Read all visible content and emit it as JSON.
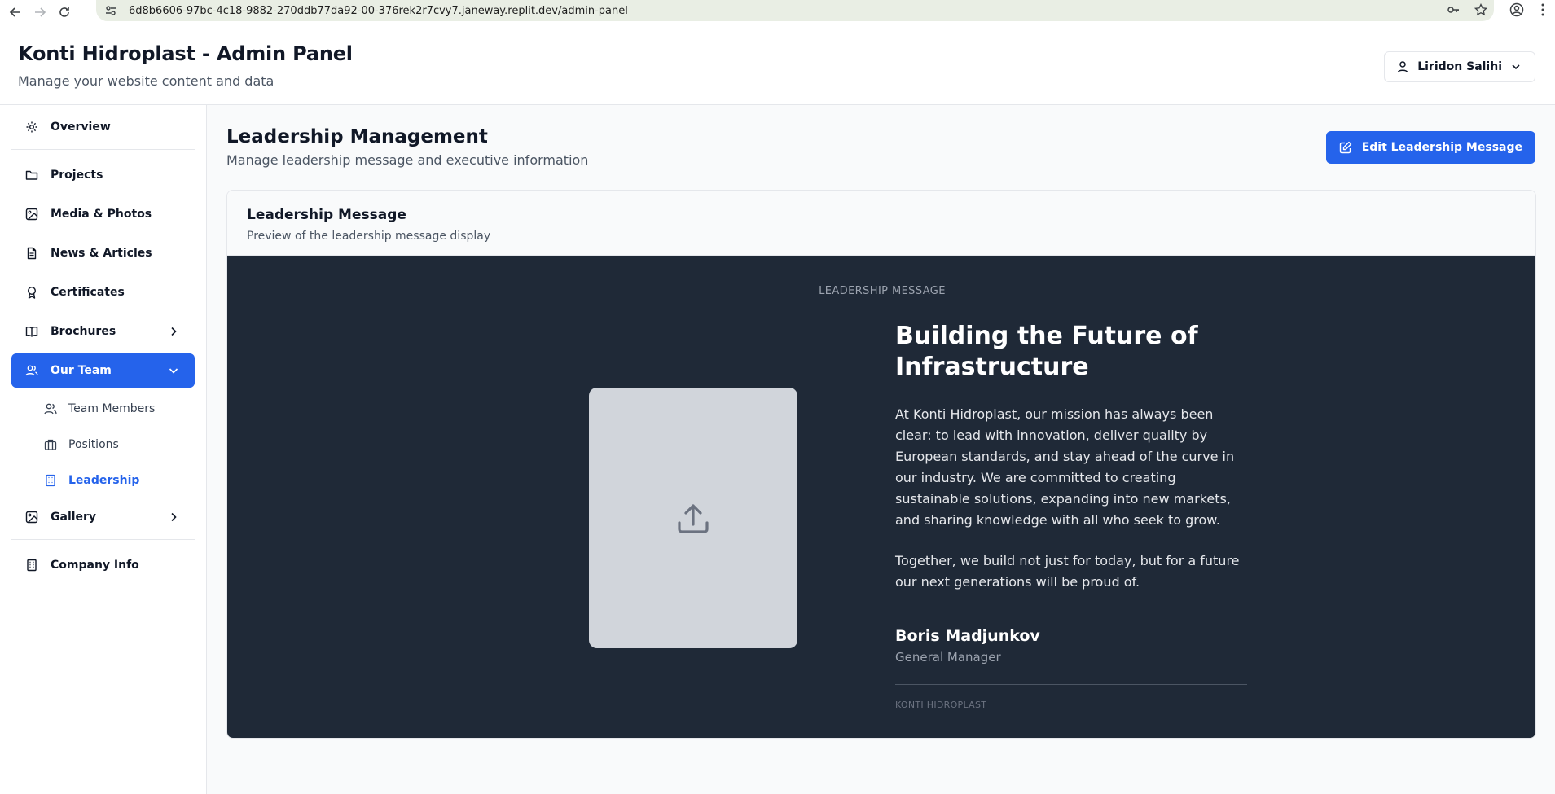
{
  "browser": {
    "url": "6d8b6606-97bc-4c18-9882-270ddb77da92-00-376rek2r7cvy7.janeway.replit.dev/admin-panel"
  },
  "header": {
    "title": "Konti Hidroplast - Admin Panel",
    "subtitle": "Manage your website content and data",
    "user_name": "Liridon Salihi"
  },
  "sidebar": {
    "items": [
      {
        "label": "Overview",
        "icon": "gear-icon"
      },
      {
        "label": "Projects",
        "icon": "folder-icon"
      },
      {
        "label": "Media & Photos",
        "icon": "image-icon"
      },
      {
        "label": "News & Articles",
        "icon": "file-text-icon"
      },
      {
        "label": "Certificates",
        "icon": "award-icon"
      },
      {
        "label": "Brochures",
        "icon": "book-icon"
      },
      {
        "label": "Our Team",
        "icon": "users-icon"
      },
      {
        "label": "Gallery",
        "icon": "image-icon"
      },
      {
        "label": "Company Info",
        "icon": "building-icon"
      }
    ],
    "team_sub": [
      {
        "label": "Team Members",
        "icon": "users-icon"
      },
      {
        "label": "Positions",
        "icon": "briefcase-icon"
      },
      {
        "label": "Leadership",
        "icon": "building-icon"
      }
    ],
    "active_item": "Our Team",
    "active_sub": "Leadership"
  },
  "page": {
    "title": "Leadership Management",
    "subtitle": "Manage leadership message and executive information",
    "edit_button": "Edit Leadership Message"
  },
  "card": {
    "title": "Leadership Message",
    "subtitle": "Preview of the leadership message display"
  },
  "preview": {
    "eyebrow": "LEADERSHIP MESSAGE",
    "headline": "Building the Future of Infrastructure",
    "paragraph1": "At Konti Hidroplast, our mission has always been clear: to lead with innovation, deliver quality by European standards, and stay ahead of the curve in our industry. We are committed to creating sustainable solutions, expanding into new markets, and sharing knowledge with all who seek to grow.",
    "paragraph2": "Together, we build not just for today, but for a future our next generations will be proud of.",
    "name": "Boris Madjunkov",
    "role": "General Manager",
    "company": "KONTI HIDROPLAST"
  },
  "colors": {
    "accent": "#2563eb",
    "preview_bg": "#1f2937",
    "photo_placeholder": "#d1d5db"
  }
}
